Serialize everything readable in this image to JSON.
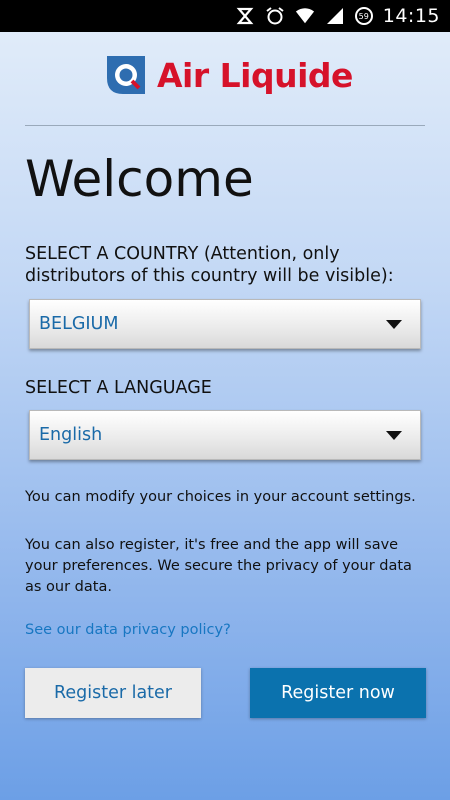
{
  "status_bar": {
    "time": "14:15",
    "battery_level": "59",
    "icons": [
      "nfc-icon",
      "alarm-icon",
      "wifi-icon",
      "signal-icon",
      "battery-icon"
    ]
  },
  "brand": {
    "name": "Air Liquide",
    "primary_color": "#d6122a",
    "secondary_color": "#2e6db0"
  },
  "welcome": {
    "title": "Welcome"
  },
  "country": {
    "label": "SELECT A COUNTRY (Attention, only distributors of this country will be visible):",
    "selected": "BELGIUM"
  },
  "language": {
    "label": "SELECT A LANGUAGE",
    "selected": "English"
  },
  "info": {
    "modify_text": "You can modify your choices in your account settings.",
    "register_text": "You can also register, it's free and the app will save your preferences. We secure the privacy of your data as our data.",
    "privacy_link": "See our data privacy policy?"
  },
  "actions": {
    "register_later": "Register later",
    "register_now": "Register now",
    "accent_color": "#0b72ae"
  }
}
